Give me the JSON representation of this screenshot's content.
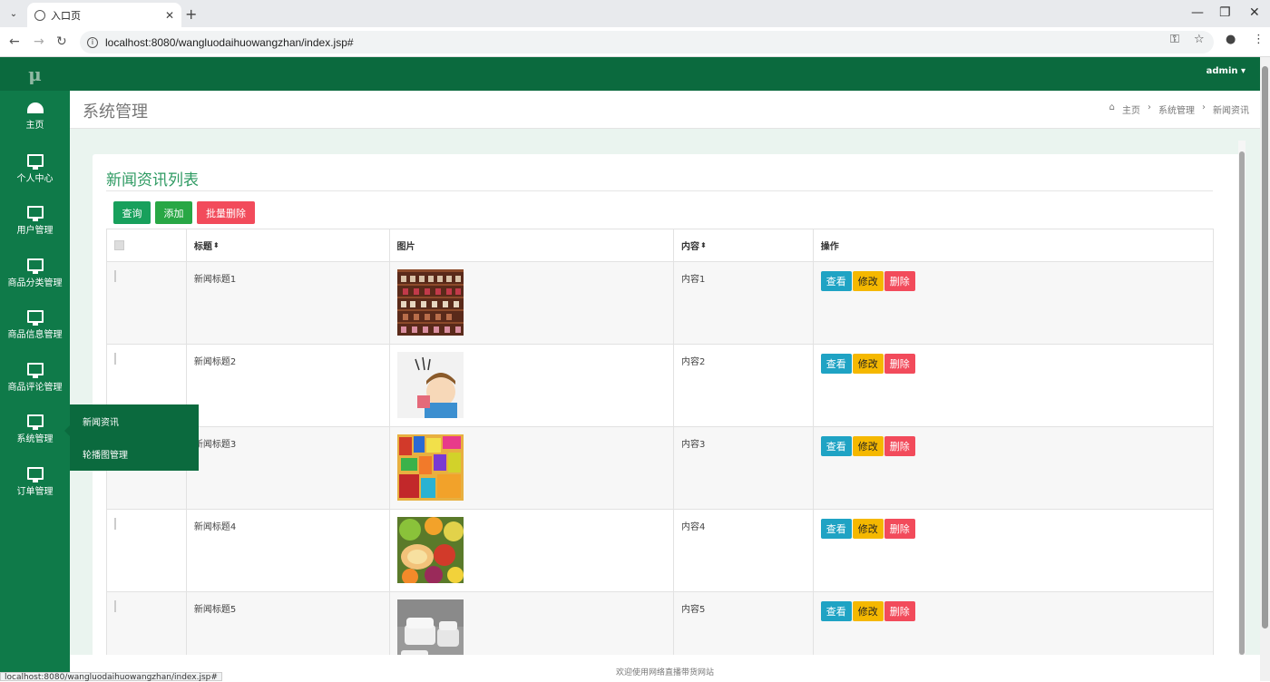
{
  "browser": {
    "tab_title": "入口页",
    "url": "localhost:8080/wangluodaihuowangzhan/index.jsp#",
    "status_url": "localhost:8080/wangluodaihuowangzhan/index.jsp#"
  },
  "sidebar": {
    "logo": "μ",
    "items": [
      {
        "label": "主页",
        "icon": "dashboard-icon"
      },
      {
        "label": "个人中心",
        "icon": "monitor-icon"
      },
      {
        "label": "用户管理",
        "icon": "monitor-icon"
      },
      {
        "label": "商品分类管理",
        "icon": "monitor-icon"
      },
      {
        "label": "商品信息管理",
        "icon": "monitor-icon"
      },
      {
        "label": "商品评论管理",
        "icon": "monitor-icon"
      },
      {
        "label": "系统管理",
        "icon": "monitor-icon"
      },
      {
        "label": "订单管理",
        "icon": "monitor-icon"
      }
    ],
    "submenu": [
      "新闻资讯",
      "轮播图管理"
    ]
  },
  "topnav": {
    "user": "admin ▾"
  },
  "pagehead": {
    "title": "系统管理",
    "breadcrumb": [
      "主页",
      "系统管理",
      "新闻资讯"
    ]
  },
  "card": {
    "title": "新闻资讯列表",
    "buttons": {
      "search": "查询",
      "add": "添加",
      "batch_delete": "批量删除"
    }
  },
  "table": {
    "headers": [
      "标题",
      "图片",
      "内容",
      "操作"
    ],
    "rows": [
      {
        "title": "新闻标题1",
        "content": "内容1",
        "image": "shoe-shelf"
      },
      {
        "title": "新闻标题2",
        "content": "内容2",
        "image": "cartoon"
      },
      {
        "title": "新闻标题3",
        "content": "内容3",
        "image": "snacks"
      },
      {
        "title": "新闻标题4",
        "content": "内容4",
        "image": "fruit"
      },
      {
        "title": "新闻标题5",
        "content": "内容5",
        "image": "sofa"
      }
    ],
    "actions": {
      "view": "查看",
      "edit": "修改",
      "delete": "删除"
    }
  },
  "footer": {
    "text": "欢迎使用网络直播带货网站"
  },
  "colors": {
    "sidebar": "#0f7a49",
    "topnav": "#0b6a3e",
    "title_green": "#2e9a62",
    "view_btn": "#1fa3c4",
    "edit_btn": "#f5b800",
    "delete_btn": "#f24b5b"
  }
}
